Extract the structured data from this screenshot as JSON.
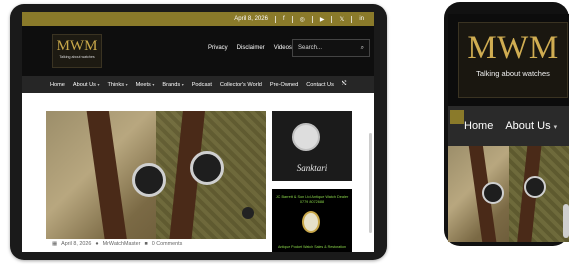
{
  "tablet": {
    "topbar": {
      "date": "April 8, 2026",
      "social_icons": [
        "facebook-icon",
        "instagram-icon",
        "youtube-icon",
        "x-icon",
        "linkedin-icon"
      ],
      "social_glyphs": [
        "f",
        "◎",
        "▶",
        "𝕏",
        "in"
      ]
    },
    "logo": {
      "name": "MWM",
      "tagline": "Talking about watches"
    },
    "top_links": [
      "Privacy",
      "Disclaimer",
      "Videos"
    ],
    "search": {
      "placeholder": "Search...",
      "icon": "search-icon",
      "glyph": "⌕"
    },
    "menu": [
      {
        "label": "Home",
        "dropdown": false
      },
      {
        "label": "About Us",
        "dropdown": true
      },
      {
        "label": "Thinks",
        "dropdown": true
      },
      {
        "label": "Meets",
        "dropdown": true
      },
      {
        "label": "Brands",
        "dropdown": true
      },
      {
        "label": "Podcast",
        "dropdown": false
      },
      {
        "label": "Collector's World",
        "dropdown": false
      },
      {
        "label": "Pre-Owned",
        "dropdown": false
      },
      {
        "label": "Contact Us",
        "dropdown": false
      }
    ],
    "shuffle_glyph": "⤭",
    "post_meta": {
      "date": "April 8, 2026",
      "author": "MrWatchMaster",
      "comments": "0 Comments"
    },
    "ads": {
      "first_brand": "Sanktari",
      "second_title": "JC Barrett & Son Ltd\nAntique Watch Dealer 0779 8072688",
      "second_footer": "Antique Pocket Watch Sales & Restoration"
    }
  },
  "phone": {
    "logo": {
      "name": "MWM",
      "tagline": "Talking about watches"
    },
    "menu": [
      {
        "label": "Home",
        "dropdown": false
      },
      {
        "label": "About Us",
        "dropdown": true
      }
    ]
  },
  "colors": {
    "accent": "#8a7a2a",
    "gold": "#c9a84a",
    "dark": "#0e0e0e",
    "menu": "#262626"
  }
}
